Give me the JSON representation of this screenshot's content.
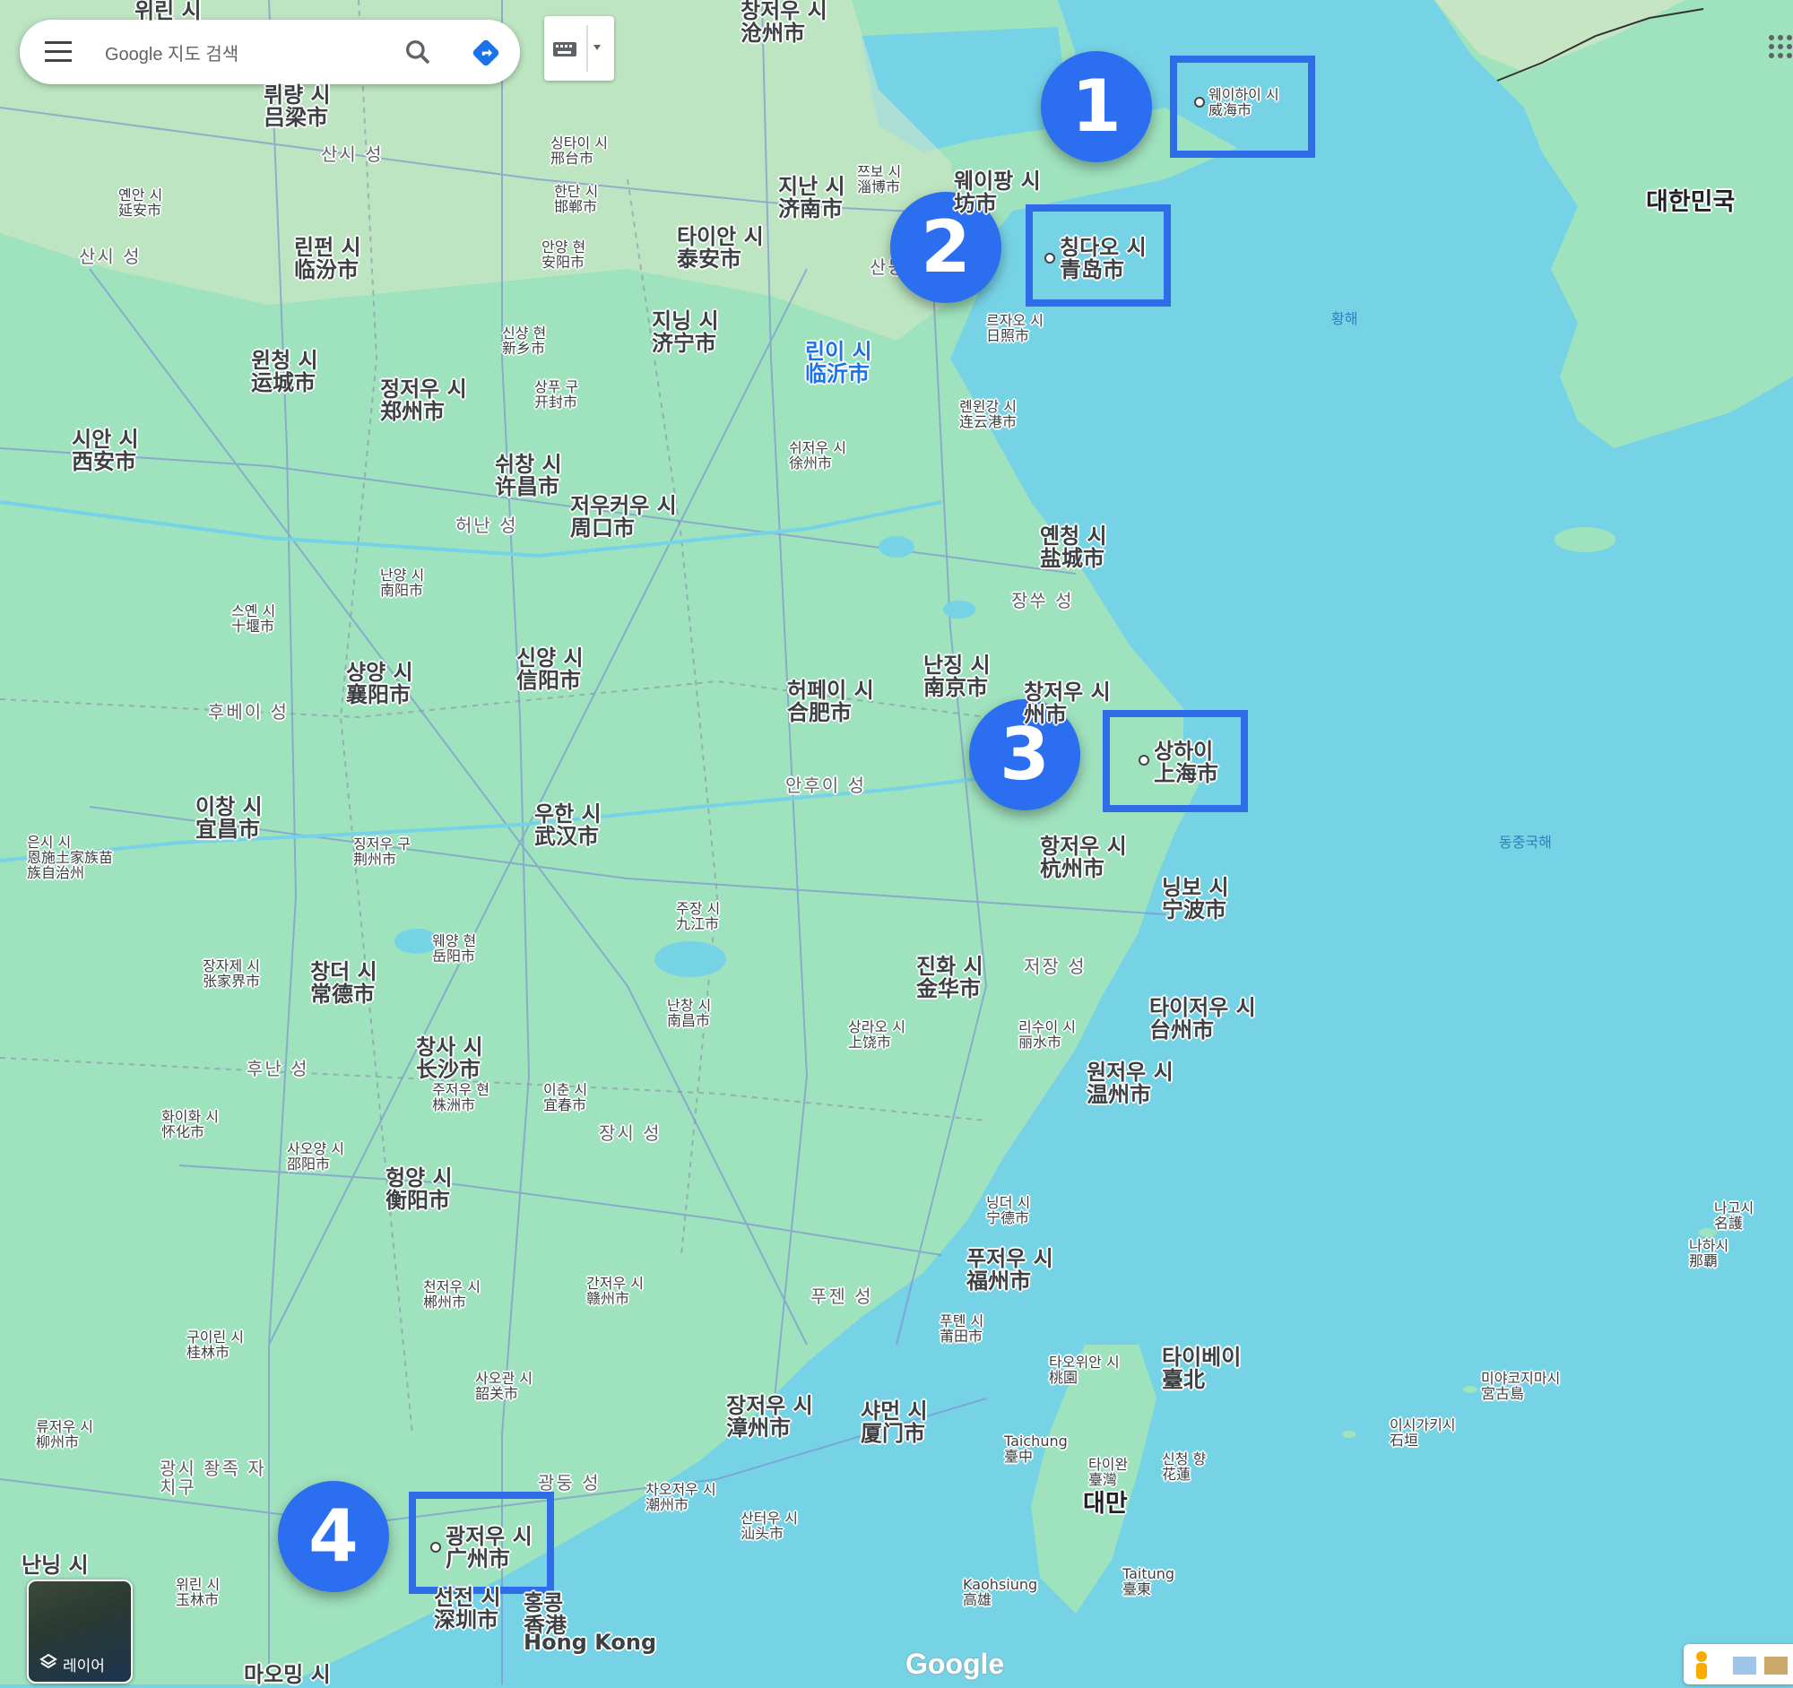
{
  "search": {
    "placeholder": "Google 지도 검색"
  },
  "layers_label": "레이어",
  "google_logo": "Google",
  "colors": {
    "water": "#76d3e6",
    "land": "#9fe2be",
    "highlight": "#2f6de8",
    "badge": "#2b6ef0"
  },
  "badges": [
    "1",
    "2",
    "3",
    "4"
  ],
  "highlighted_cities": [
    {
      "ko": "웨이하이 시",
      "zh": "威海市"
    },
    {
      "ko": "칭다오 시",
      "zh": "青岛市"
    },
    {
      "ko": "상하이",
      "zh": "上海市"
    },
    {
      "ko": "광저우 시",
      "zh": "广州市"
    }
  ],
  "cities": [
    {
      "ko": "지난 시",
      "zh": "济南市"
    },
    {
      "ko": "웨이팡 시",
      "zh": "坊市"
    },
    {
      "ko": "쯔보 시",
      "zh": "淄博市"
    },
    {
      "ko": "타이안 시",
      "zh": "泰安市"
    },
    {
      "ko": "지닝 시",
      "zh": "济宁市"
    },
    {
      "ko": "린이 시",
      "zh": "临沂市"
    },
    {
      "ko": "르자오 시",
      "zh": "日照市"
    },
    {
      "ko": "롄윈강 시",
      "zh": "连云港市"
    },
    {
      "ko": "쉬저우 시",
      "zh": "徐州市"
    },
    {
      "ko": "옌청 시",
      "zh": "盐城市"
    },
    {
      "ko": "난징 시",
      "zh": "南京市"
    },
    {
      "ko": "창저우 시",
      "zh": "州市"
    },
    {
      "ko": "허페이 시",
      "zh": "合肥市"
    },
    {
      "ko": "항저우 시",
      "zh": "杭州市"
    },
    {
      "ko": "닝보 시",
      "zh": "宁波市"
    },
    {
      "ko": "진화 시",
      "zh": "金华市"
    },
    {
      "ko": "타이저우 시",
      "zh": "台州市"
    },
    {
      "ko": "원저우 시",
      "zh": "温州市"
    },
    {
      "ko": "리수이 시",
      "zh": "丽水市"
    },
    {
      "ko": "상라오 시",
      "zh": "上饶市"
    },
    {
      "ko": "난창 시",
      "zh": "南昌市"
    },
    {
      "ko": "주장 시",
      "zh": "九江市"
    },
    {
      "ko": "우한 시",
      "zh": "武汉市"
    },
    {
      "ko": "창사 시",
      "zh": "长沙市"
    },
    {
      "ko": "주저우 현",
      "zh": "株洲市"
    },
    {
      "ko": "이춘 시",
      "zh": "宜春市"
    },
    {
      "ko": "헝양 시",
      "zh": "衡阳市"
    },
    {
      "ko": "간저우 시",
      "zh": "赣州市"
    },
    {
      "ko": "푸저우 시",
      "zh": "福州市"
    },
    {
      "ko": "닝더 시",
      "zh": "宁德市"
    },
    {
      "ko": "푸톈 시",
      "zh": "莆田市"
    },
    {
      "ko": "샤먼 시",
      "zh": "厦门市"
    },
    {
      "ko": "장저우 시",
      "zh": "漳州市"
    },
    {
      "ko": "산터우 시",
      "zh": "汕头市"
    },
    {
      "ko": "차오저우 시",
      "zh": "潮州市"
    },
    {
      "ko": "사오관 시",
      "zh": "韶关市"
    },
    {
      "ko": "천저우 시",
      "zh": "郴州市"
    },
    {
      "ko": "구이린 시",
      "zh": "桂林市"
    },
    {
      "ko": "류저우 시",
      "zh": "柳州市"
    },
    {
      "ko": "위린 시",
      "zh": "玉林市"
    },
    {
      "ko": "시안 시",
      "zh": "西安市"
    },
    {
      "ko": "정저우 시",
      "zh": "郑州市"
    },
    {
      "ko": "쉬창 시",
      "zh": "许昌市"
    },
    {
      "ko": "저우커우 시",
      "zh": "周口市"
    },
    {
      "ko": "신양 시",
      "zh": "信阳市"
    },
    {
      "ko": "샹양 시",
      "zh": "襄阳市"
    },
    {
      "ko": "이창 시",
      "zh": "宜昌市"
    },
    {
      "ko": "징저우 구",
      "zh": "荆州市"
    },
    {
      "ko": "창더 시",
      "zh": "常德市"
    },
    {
      "ko": "웨양 현",
      "zh": "岳阳市"
    },
    {
      "ko": "장자제 시",
      "zh": "张家界市"
    },
    {
      "ko": "화이화 시",
      "zh": "怀化市"
    },
    {
      "ko": "사오양 시",
      "zh": "邵阳市"
    },
    {
      "ko": "린펀 시",
      "zh": "临汾市"
    },
    {
      "ko": "윈청 시",
      "zh": "运城市"
    },
    {
      "ko": "옌안 시",
      "zh": "延安市"
    },
    {
      "ko": "싱타이 시",
      "zh": "邢台市"
    },
    {
      "ko": "한단 시",
      "zh": "邯郸市"
    },
    {
      "ko": "안양 현",
      "zh": "安阳市"
    },
    {
      "ko": "신샹 현",
      "zh": "新乡市"
    },
    {
      "ko": "상푸 구",
      "zh": "开封市"
    },
    {
      "ko": "난양 시",
      "zh": "南阳市"
    },
    {
      "ko": "스옌 시",
      "zh": "十堰市"
    },
    {
      "ko": "뤼량 시",
      "zh": "吕梁市"
    },
    {
      "ko": "은시 시",
      "zh": "恩施土家族苗族自治州"
    },
    {
      "ko": "타이베이",
      "zh": "臺北"
    },
    {
      "ko": "타오위안 시",
      "zh": "桃園"
    },
    {
      "ko": "Taichung",
      "zh": "臺中"
    },
    {
      "ko": "타이완",
      "zh": "臺灣"
    },
    {
      "ko": "신청 향",
      "zh": "花蓮"
    },
    {
      "ko": "Kaohsiung",
      "zh": "高雄"
    },
    {
      "ko": "Taitung",
      "zh": "臺東"
    },
    {
      "ko": "미야코지마시",
      "zh": "宮古島"
    },
    {
      "ko": "이시가키시",
      "zh": "石垣"
    },
    {
      "ko": "나고시",
      "zh": "名護"
    },
    {
      "ko": "나하시",
      "zh": "那覇"
    },
    {
      "ko": "선전 시",
      "zh": "深圳市"
    },
    {
      "ko": "홍콩",
      "zh": "香港"
    },
    {
      "ko": "Hong Kong",
      "zh": ""
    },
    {
      "ko": "난닝 시",
      "zh": ""
    },
    {
      "ko": "마오밍 시",
      "zh": ""
    },
    {
      "ko": "창저우 시",
      "zh": "沧州市"
    },
    {
      "ko": "위린 시",
      "zh": ""
    }
  ],
  "regions": {
    "shanxi1": "산시 성",
    "shanxi2": "산시 성",
    "henan": "허난 성",
    "hubei": "후베이 성",
    "hunan": "후난 성",
    "jiangsu": "장쑤 성",
    "anhui": "안후이 성",
    "zhejiang": "저장 성",
    "jiangxi": "장시 성",
    "fujian": "푸젠 성",
    "guangdong": "광둥 성",
    "guangxi": "광시 좡족 자치구",
    "shandong": "산둥",
    "yellow_sea": "황해",
    "east_china_sea": "동중국해",
    "korea": "대한민국",
    "taiwan": "대만"
  }
}
